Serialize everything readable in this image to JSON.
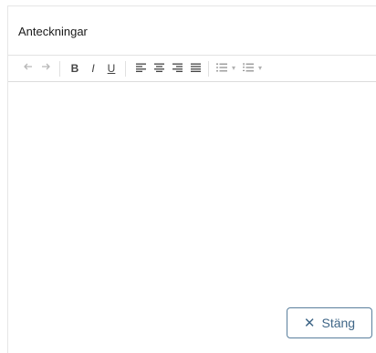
{
  "dialog": {
    "title": "Anteckningar"
  },
  "toolbar": {
    "undo_icon": "undo-icon",
    "redo_icon": "redo-icon",
    "bold_label": "B",
    "italic_label": "I",
    "underline_label": "U",
    "align_left_icon": "align-left-icon",
    "align_center_icon": "align-center-icon",
    "align_right_icon": "align-right-icon",
    "align_justify_icon": "align-justify-icon",
    "bullet_list_icon": "bullet-list-icon",
    "numbered_list_icon": "numbered-list-icon",
    "dropdown_caret": "▾"
  },
  "editor": {
    "content": ""
  },
  "footer": {
    "close_icon": "✕",
    "close_label": "Stäng"
  },
  "colors": {
    "accent": "#3f6687",
    "button_border": "#5a7f9d",
    "border": "#e6e6e6",
    "icon": "#444444",
    "icon_disabled": "#b8b8b8"
  }
}
